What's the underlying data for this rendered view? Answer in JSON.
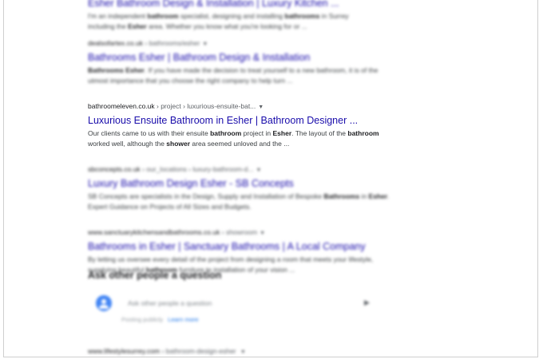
{
  "top_result": {
    "title": "Esher Bathroom Design & Installation | Luxury Kitchen ...",
    "snippet_html": "I'm an independent <b>bathroom</b> specialist, designing and installing <b>bathrooms</b> in Surrey including the <b>Esher</b> area. Whether you know what you're looking for or ..."
  },
  "results": [
    {
      "domain": "dealsofartex.co.uk",
      "path": "› bathrooms/esher",
      "title": "Bathrooms Esher | Bathroom Design & Installation",
      "snippet_html": "<b>Bathrooms Esher</b>. If you have made the decision to treat yourself to a new bathroom, it is of the utmost importance that you choose the right company to help turn ...",
      "blurred": true
    },
    {
      "domain": "bathroomeleven.co.uk",
      "path": "› project › luxurious-ensuite-bat...",
      "title": "Luxurious Ensuite Bathroom in Esher | Bathroom Designer ...",
      "snippet_html": "Our clients came to us with their ensuite <b>bathroom</b> project in <b>Esher</b>. The layout of the <b>bathroom</b> worked well, although the <b>shower</b> area seemed unloved and the ...",
      "blurred": false
    },
    {
      "domain": "sbconcepts.co.uk",
      "path": "› our_locations › luxury-bathroom-d...",
      "title": "Luxury Bathroom Design Esher - SB Concepts",
      "snippet_html": "SB Concepts are specialists in the Design, Supply and Installation of Bespoke <b>Bathrooms</b> in <b>Esher</b>. Expert Guidance on Projects of All Sizes and Budgets.",
      "blurred": true
    },
    {
      "domain": "www.sanctuarykitchensandbathrooms.co.uk",
      "path": "› showroom",
      "title": "Bathrooms in Esher | Sanctuary Bathrooms | A Local Company",
      "snippet_html": "By letting us oversee every detail of the project from designing a room that meets your lifestyle, supplying beautiful <b>bathroom</b> furniture to installation of your vision ...",
      "blurred": true
    }
  ],
  "paa": {
    "heading": "Ask other people a question",
    "placeholder": "Ask other people a question",
    "sub": "Posting publicly",
    "learn_more": "Learn more"
  },
  "bottom_result": {
    "domain": "www.lifestylesurrey.com",
    "path": "› bathroom-design-esher"
  },
  "colors": {
    "link": "#1a0dab",
    "text": "#3c4043",
    "accent": "#4285f4"
  }
}
